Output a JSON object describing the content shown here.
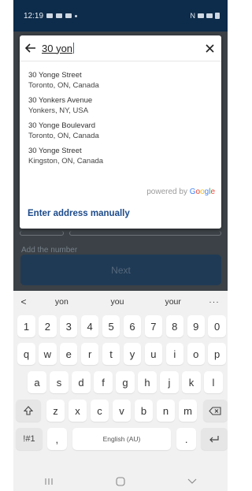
{
  "status_bar": {
    "time": "12:19"
  },
  "background": {
    "label": "Add the number ",
    "next_label": "Next"
  },
  "dialog": {
    "search_value": "30 yon",
    "results": [
      {
        "line1": "30 Yonge Street",
        "line2": "Toronto, ON, Canada"
      },
      {
        "line1": "30 Yonkers Avenue",
        "line2": "Yonkers, NY, USA"
      },
      {
        "line1": "30 Yonge Boulevard",
        "line2": "Toronto, ON, Canada"
      },
      {
        "line1": "30 Yonge Street",
        "line2": "Kingston, ON, Canada"
      }
    ],
    "powered_by": "powered by",
    "google": [
      "G",
      "o",
      "o",
      "g",
      "l",
      "e"
    ],
    "manual_link": "Enter address manually"
  },
  "colors": {
    "accent": "#1c4a8a",
    "status_bar": "#0d2b4a",
    "google": [
      "#4285F4",
      "#EA4335",
      "#FBBC05",
      "#4285F4",
      "#34A853",
      "#EA4335"
    ]
  },
  "keyboard": {
    "suggestions": [
      "yon",
      "you",
      "your"
    ],
    "more_label": "···",
    "row_numbers": [
      "1",
      "2",
      "3",
      "4",
      "5",
      "6",
      "7",
      "8",
      "9",
      "0"
    ],
    "row_top": [
      "q",
      "w",
      "e",
      "r",
      "t",
      "y",
      "u",
      "i",
      "o",
      "p"
    ],
    "row_middle": [
      "a",
      "s",
      "d",
      "f",
      "g",
      "h",
      "j",
      "k",
      "l"
    ],
    "row_bottom": [
      "z",
      "x",
      "c",
      "v",
      "b",
      "n",
      "m"
    ],
    "symbols_label": "!#1",
    "comma_label": ",",
    "space_label": "English (AU)",
    "period_label": "."
  }
}
